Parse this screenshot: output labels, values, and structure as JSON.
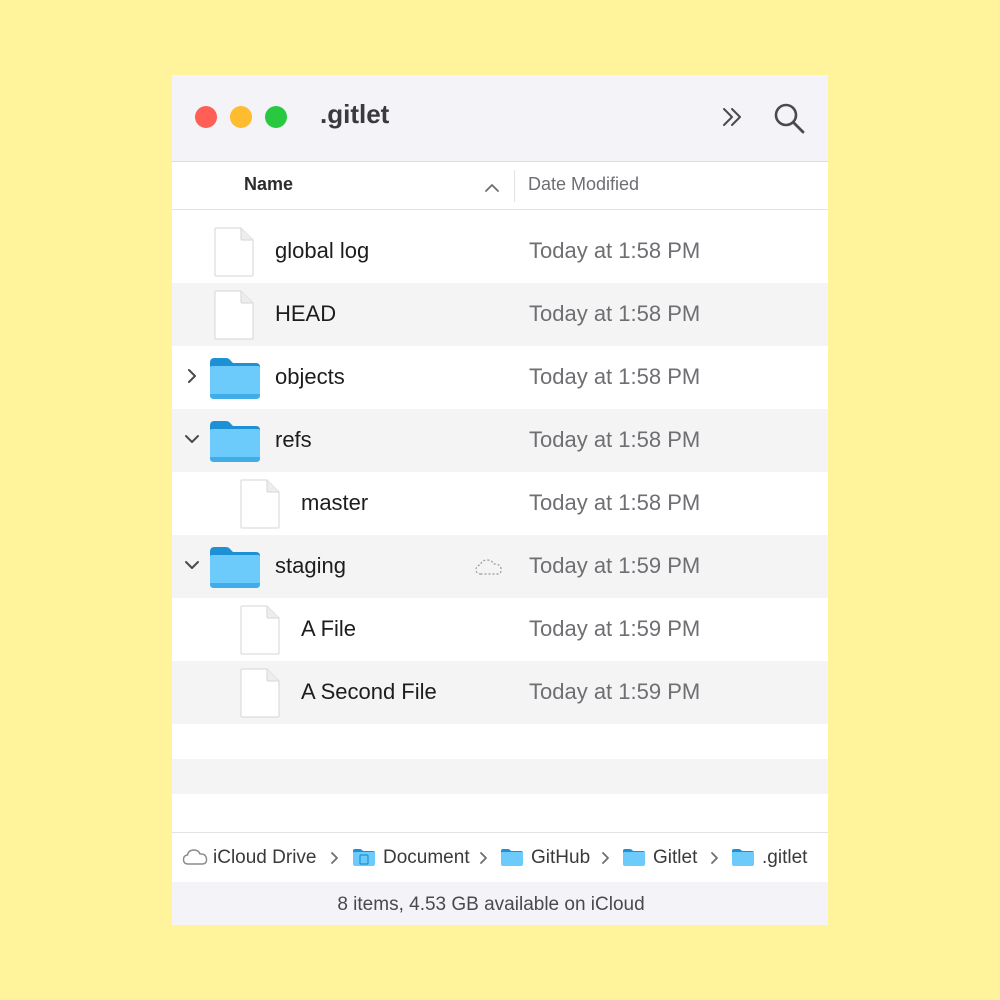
{
  "window": {
    "title": ".gitlet"
  },
  "toolbar": {
    "more_icon": "chevron-double-right-icon",
    "search_icon": "magnifying-glass-icon"
  },
  "columns": {
    "name": "Name",
    "date_modified": "Date Modified",
    "sort": "ascending"
  },
  "rows": [
    {
      "name": "global log",
      "date": "Today at 1:58 PM",
      "kind": "file",
      "indent": 0,
      "expanded": null
    },
    {
      "name": "HEAD",
      "date": "Today at 1:58 PM",
      "kind": "file",
      "indent": 0,
      "expanded": null
    },
    {
      "name": "objects",
      "date": "Today at 1:58 PM",
      "kind": "folder",
      "indent": 0,
      "expanded": false
    },
    {
      "name": "refs",
      "date": "Today at 1:58 PM",
      "kind": "folder",
      "indent": 0,
      "expanded": true
    },
    {
      "name": "master",
      "date": "Today at 1:58 PM",
      "kind": "file",
      "indent": 1,
      "expanded": null
    },
    {
      "name": "staging",
      "date": "Today at 1:59 PM",
      "kind": "folder",
      "indent": 0,
      "expanded": true,
      "cloud_status": "not-downloaded"
    },
    {
      "name": "A File",
      "date": "Today at 1:59 PM",
      "kind": "file",
      "indent": 1,
      "expanded": null
    },
    {
      "name": "A Second File",
      "date": "Today at 1:59 PM",
      "kind": "file",
      "indent": 1,
      "expanded": null
    }
  ],
  "path_bar": {
    "items": [
      {
        "label": "iCloud Drive",
        "icon": "cloud-icon"
      },
      {
        "label": "Document",
        "icon": "documents-folder-icon"
      },
      {
        "label": "GitHub",
        "icon": "folder-icon"
      },
      {
        "label": "Gitlet",
        "icon": "folder-icon"
      },
      {
        "label": ".gitlet",
        "icon": "folder-icon"
      }
    ]
  },
  "status_bar": {
    "text": "8 items, 4.53 GB available on iCloud"
  },
  "colors": {
    "background": "#FFF49C",
    "folder_blue": "#5AC8FA",
    "close": "#FF5F57",
    "minimize": "#FEBC2E",
    "zoom": "#28C840"
  }
}
